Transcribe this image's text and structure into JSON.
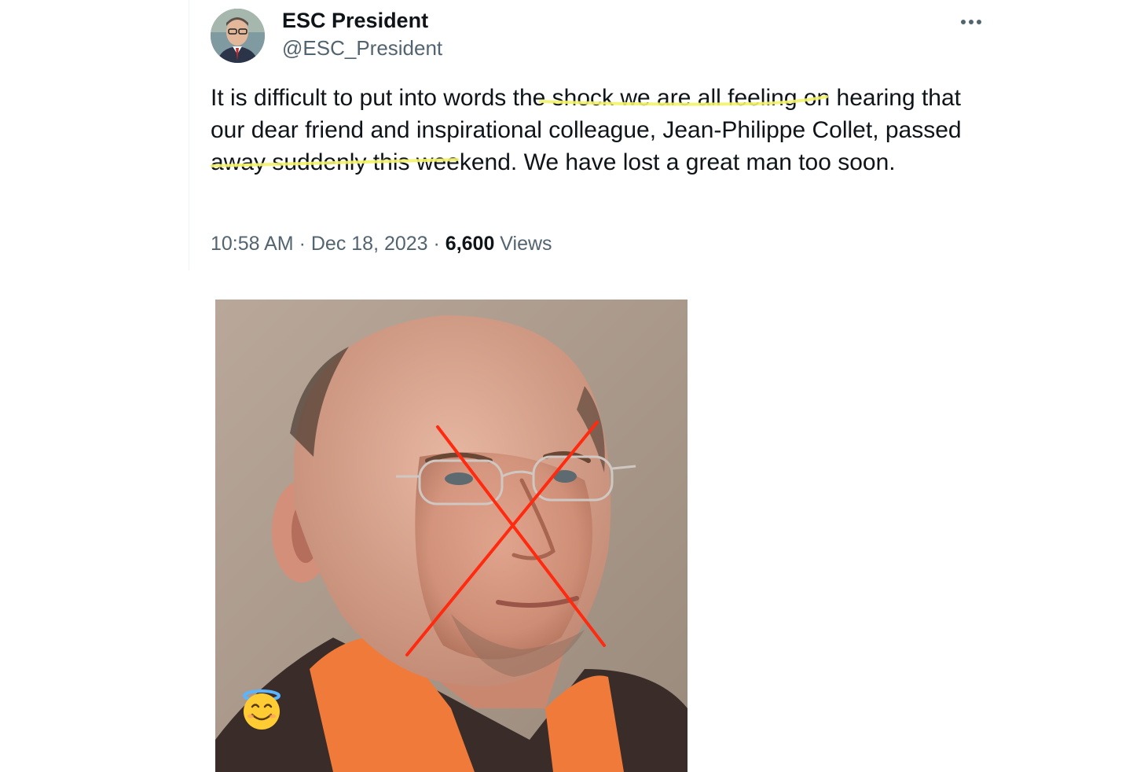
{
  "author": {
    "name": "ESC President",
    "handle": "@ESC_President"
  },
  "tweet": {
    "text_part1": "It is difficult to put into words t",
    "text_highlight1": "he shock we are all feeling",
    "text_part2": " on hearing that our dear friend and inspirational colleague, Jean-Philippe Collet, ",
    "text_highlight2": "passed away suddenly",
    "text_part3": " this weekend. We have lost a great man too soon."
  },
  "meta": {
    "time": "10:58 AM",
    "separator": " · ",
    "date": "Dec 18, 2023",
    "views_count": "6,600",
    "views_label": " Views"
  },
  "icons": {
    "more": "more-dots-icon",
    "emoji": "smiling-face-with-halo-icon"
  },
  "colors": {
    "text_primary": "#0f1419",
    "text_secondary": "#536471",
    "highlight_underline": "#f3f36a",
    "cross_mark": "#ff2a10",
    "shirt": "#f07a3a"
  }
}
